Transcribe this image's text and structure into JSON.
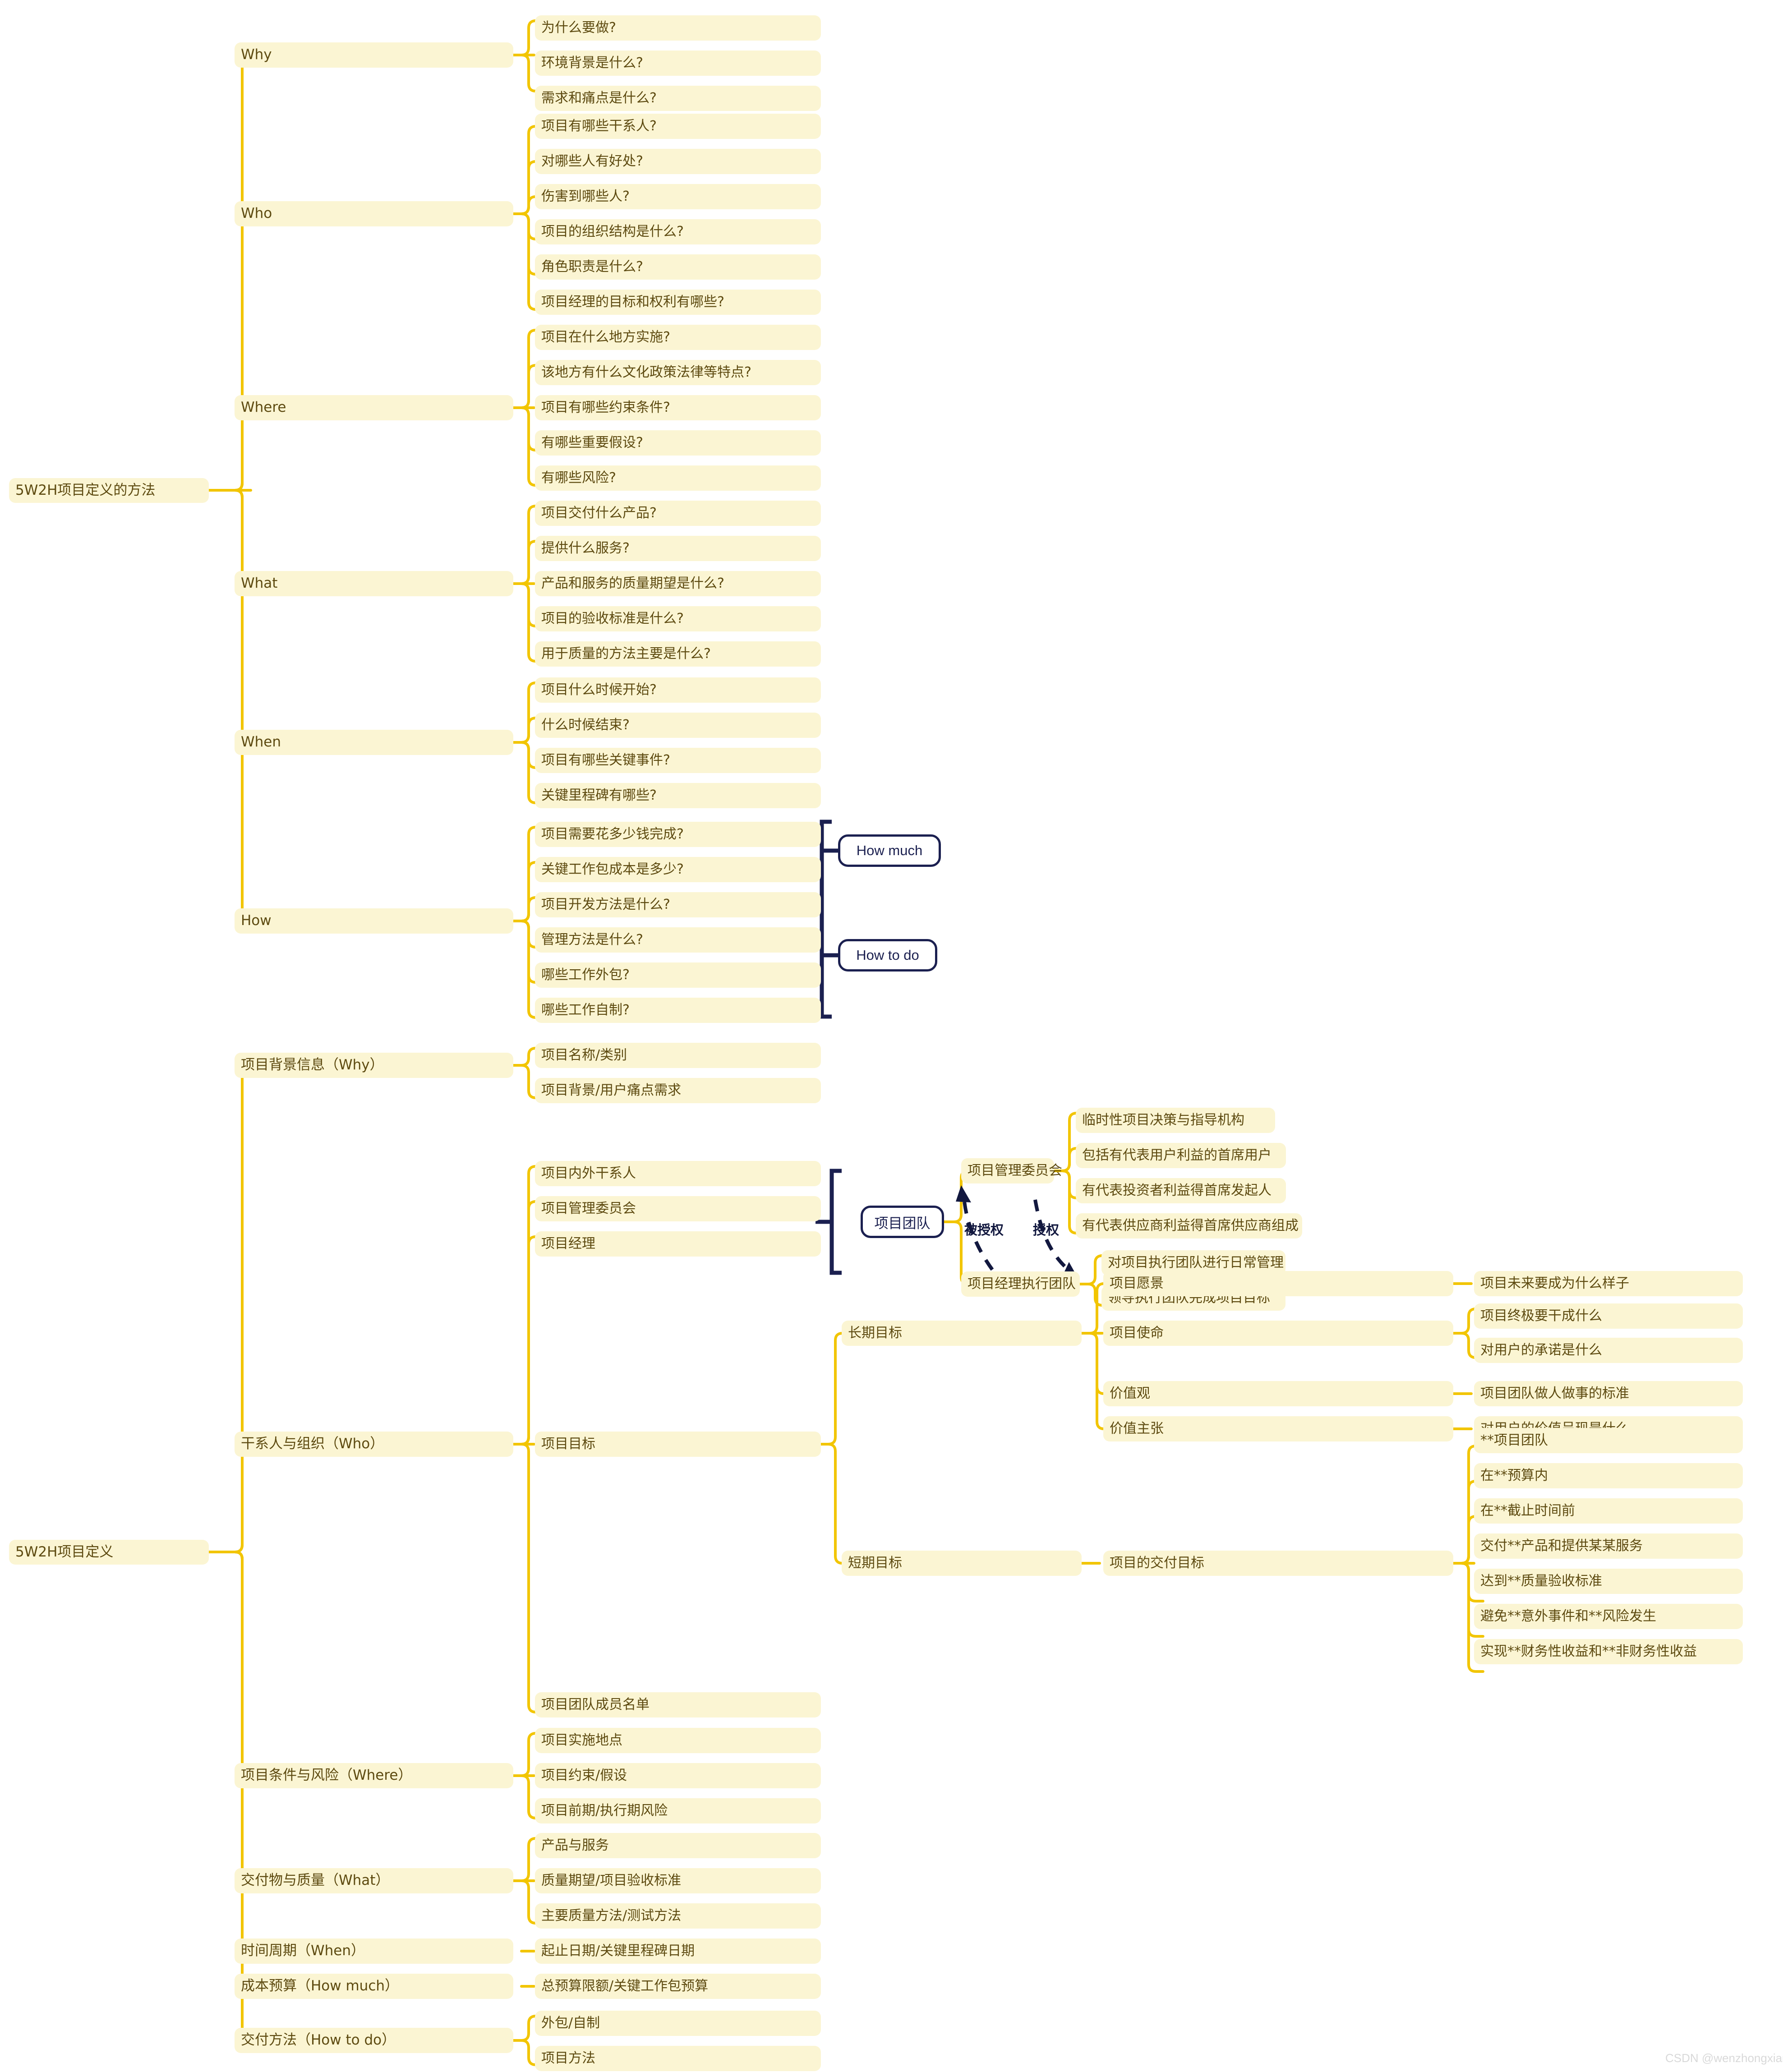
{
  "watermark": "CSDN @wenzhongxiang",
  "colors": {
    "node_fill": "#fbf5d3",
    "node_text": "#5d4a10",
    "edge": "#f2c500",
    "box_stroke": "#1b2050",
    "box_text": "#1b2050",
    "background": "#ffffff"
  },
  "map1": {
    "root": "5W2H项目定义的方法",
    "branches": [
      {
        "label": "Why",
        "children": [
          "为什么要做?",
          "环境背景是什么?",
          "需求和痛点是什么?"
        ]
      },
      {
        "label": "Who",
        "children": [
          "项目有哪些干系人?",
          "对哪些人有好处?",
          "伤害到哪些人?",
          "项目的组织结构是什么?",
          "角色职责是什么?",
          "项目经理的目标和权利有哪些?"
        ]
      },
      {
        "label": "Where",
        "children": [
          "项目在什么地方实施?",
          "该地方有什么文化政策法律等特点?",
          "项目有哪些约束条件?",
          "有哪些重要假设?",
          "有哪些风险?"
        ]
      },
      {
        "label": "What",
        "children": [
          "项目交付什么产品?",
          "提供什么服务?",
          "产品和服务的质量期望是什么?",
          "项目的验收标准是什么?",
          "用于质量的方法主要是什么?"
        ]
      },
      {
        "label": "When",
        "children": [
          "项目什么时候开始?",
          "什么时候结束?",
          "项目有哪些关键事件?",
          "关键里程碑有哪些?"
        ]
      },
      {
        "label": "How",
        "children": [
          "项目需要花多少钱完成?",
          "关键工作包成本是多少?",
          "项目开发方法是什么?",
          "管理方法是什么?",
          "哪些工作外包?",
          "哪些工作自制?"
        ]
      }
    ],
    "group_boxes": [
      {
        "label": "How much"
      },
      {
        "label": "How to do"
      }
    ]
  },
  "map2": {
    "root": "5W2H项目定义",
    "branches": [
      {
        "label": "项目背景信息（Why）",
        "children": [
          {
            "label": "项目名称/类别"
          },
          {
            "label": "项目背景/用户痛点需求"
          }
        ]
      },
      {
        "label": "干系人与组织（Who）",
        "children": [
          {
            "label": "项目内外干系人"
          },
          {
            "label": "项目管理委员会"
          },
          {
            "label": "项目经理"
          },
          {
            "label": "项目目标"
          },
          {
            "label": "项目团队成员名单"
          }
        ]
      },
      {
        "label": "项目条件与风险（Where）",
        "children": [
          {
            "label": "项目实施地点"
          },
          {
            "label": "项目约束/假设"
          },
          {
            "label": "项目前期/执行期风险"
          }
        ]
      },
      {
        "label": "交付物与质量（What）",
        "children": [
          {
            "label": "产品与服务"
          },
          {
            "label": "质量期望/项目验收标准"
          },
          {
            "label": "主要质量方法/测试方法"
          }
        ]
      },
      {
        "label": "时间周期（When）",
        "children": [
          {
            "label": "起止日期/关键里程碑日期"
          }
        ]
      },
      {
        "label": "成本预算（How much）",
        "children": [
          {
            "label": "总预算限额/关键工作包预算"
          }
        ]
      },
      {
        "label": "交付方法（How to do）",
        "children": [
          {
            "label": "外包/自制"
          },
          {
            "label": "项目方法"
          }
        ]
      }
    ]
  },
  "team_cluster": {
    "box_label": "项目团队",
    "committee": {
      "label": "项目管理委员会",
      "children": [
        "临时性项目决策与指导机构",
        "包括有代表用户利益的首席用户",
        "有代表投资者利益得首席发起人",
        "有代表供应商利益得首席供应商组成"
      ]
    },
    "exec_team": {
      "label": "项目经理执行团队",
      "children": [
        "对项目执行团队进行日常管理",
        "领导执行团队完成项目目标"
      ]
    },
    "edge_labels": {
      "delegated": "被授权",
      "delegate": "授权"
    }
  },
  "goals": {
    "long_term": {
      "label": "长期目标",
      "items": [
        {
          "label": "项目愿景",
          "details": [
            "项目未来要成为什么样子"
          ]
        },
        {
          "label": "项目使命",
          "details": [
            "项目终极要干成什么",
            "对用户的承诺是什么"
          ]
        },
        {
          "label": "价值观",
          "details": [
            "项目团队做人做事的标准"
          ]
        },
        {
          "label": "价值主张",
          "details": [
            "对用户的价值呈现是什么"
          ]
        }
      ]
    },
    "short_term": {
      "label": "短期目标",
      "items": [
        {
          "label": "项目的交付目标",
          "details": [
            "**项目团队",
            "在**预算内",
            "在**截止时间前",
            "交付**产品和提供某某服务",
            "达到**质量验收标准",
            "避免**意外事件和**风险发生",
            "实现**财务性收益和**非财务性收益"
          ]
        }
      ]
    }
  }
}
